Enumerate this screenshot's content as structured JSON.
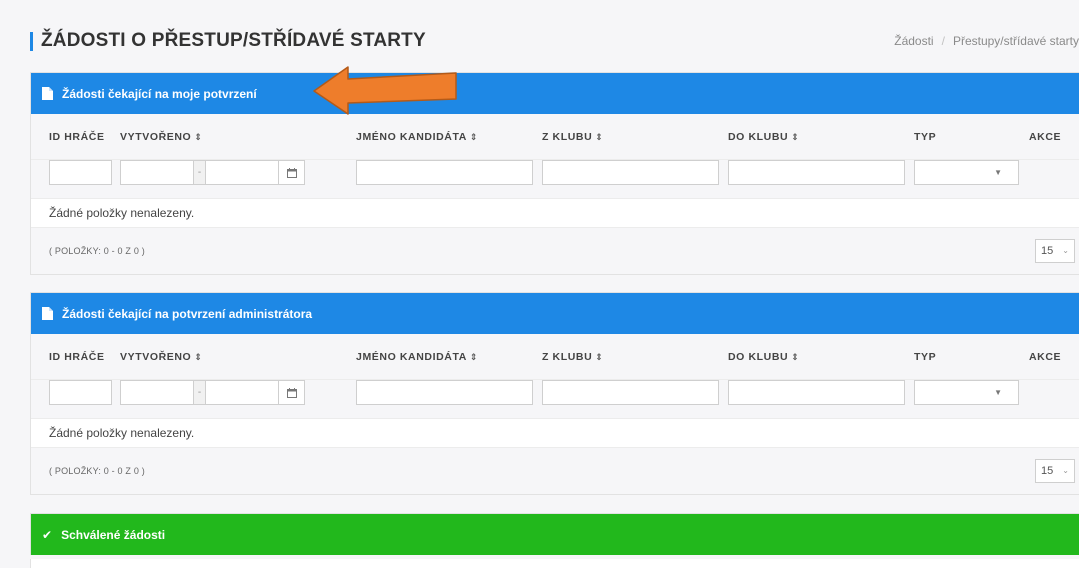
{
  "page": {
    "title": "ŽÁDOSTI O PŘESTUP/STŘÍDAVÉ STARTY",
    "breadcrumb": [
      "Žádosti",
      "/",
      "Přestupy/střídavé starty"
    ]
  },
  "columns": {
    "id": "ID HRÁČE",
    "created": "VYTVOŘENO",
    "candidate": "JMÉNO KANDIDÁTA",
    "from_club": "Z KLUBU",
    "to_club": "DO KLUBU",
    "type": "TYP",
    "action": "AKCE",
    "sort_glyph": "⇕"
  },
  "filters": {
    "date_separator": "-"
  },
  "panels": [
    {
      "title": "Žádosti čekající na moje potvrzení",
      "empty_text": "Žádné položky nenalezeny.",
      "count_text": "( POLOŽKY: 0 - 0 Z 0 )",
      "page_size": "15",
      "color": "#1e88e5"
    },
    {
      "title": "Žádosti čekající na potvrzení administrátora",
      "empty_text": "Žádné položky nenalezeny.",
      "count_text": "( POLOŽKY: 0 - 0 Z 0 )",
      "page_size": "15",
      "color": "#1e88e5"
    },
    {
      "title": "Schválené žádosti",
      "color": "#22b81c"
    }
  ],
  "icons": {
    "panel1": "document-icon",
    "panel2": "document-icon",
    "panel3": "check-icon",
    "calendar": "calendar-icon",
    "annotation": "orange-arrow"
  },
  "colors": {
    "accent_blue": "#1e88e5",
    "success_green": "#22b81c",
    "annotation_orange": "#ee7d2b"
  }
}
